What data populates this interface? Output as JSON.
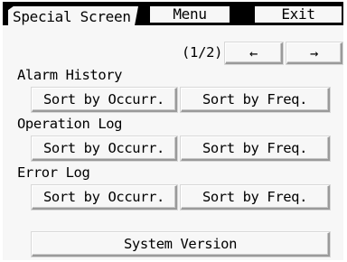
{
  "header": {
    "title_tab": "Special Screen",
    "menu_label": "Menu",
    "exit_label": "Exit"
  },
  "pager": {
    "page_indicator": "(1/2)",
    "prev_icon": "left-arrow",
    "next_icon": "right-arrow",
    "prev_glyph": "←",
    "next_glyph": "→"
  },
  "sections": [
    {
      "title": "Alarm History",
      "sort_occurrence_label": "Sort by Occurr.",
      "sort_frequency_label": "Sort by Freq."
    },
    {
      "title": "Operation Log",
      "sort_occurrence_label": "Sort by Occurr.",
      "sort_frequency_label": "Sort by Freq."
    },
    {
      "title": "Error Log",
      "sort_occurrence_label": "Sort by Occurr.",
      "sort_frequency_label": "Sort by Freq."
    }
  ],
  "footer": {
    "system_version_label": "System Version"
  },
  "colors": {
    "background": "#f7f7f7",
    "header_bar": "#000000",
    "button_shadow": "#9a9a9a"
  }
}
